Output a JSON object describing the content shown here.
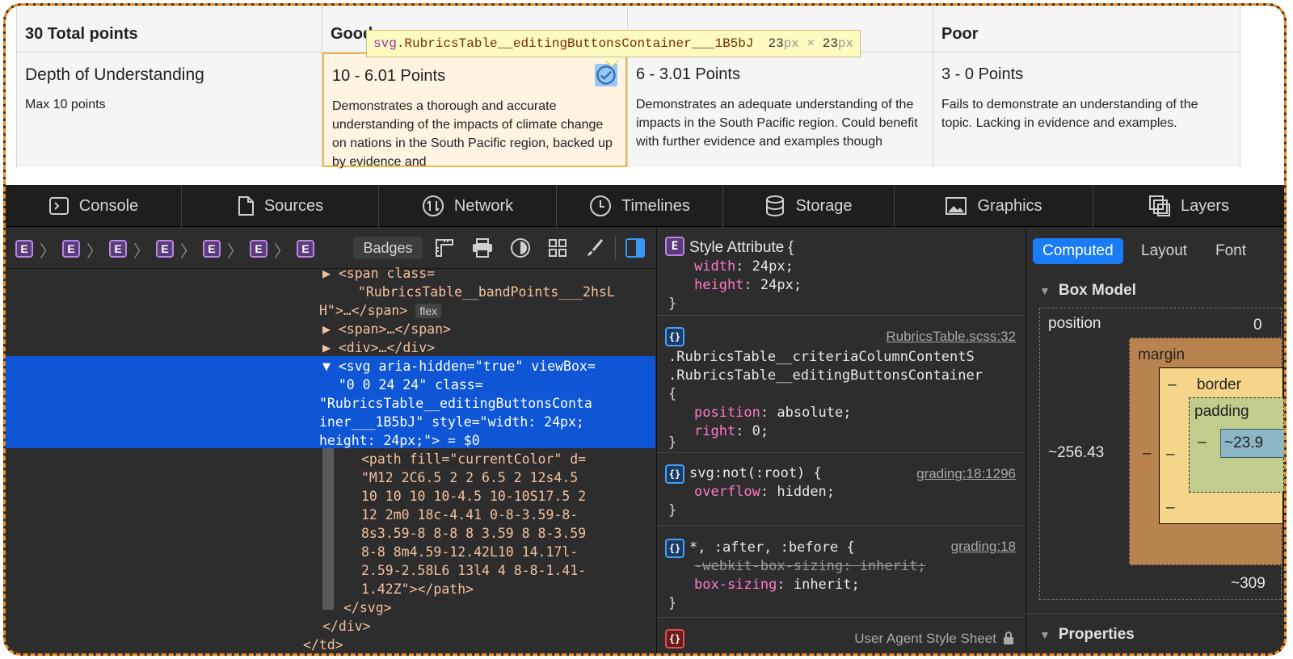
{
  "rubric": {
    "columns": [
      {
        "header": "30 Total points"
      },
      {
        "header": "Good"
      },
      {
        "header": ""
      },
      {
        "header": "Poor"
      }
    ],
    "criterion": {
      "title": "Depth of Understanding",
      "max": "Max 10 points"
    },
    "bands": [
      {
        "points": "10 - 6.01 Points",
        "desc": "Demonstrates a thorough and accurate understanding of the impacts of climate change on nations in the South Pacific region, backed up by evidence and",
        "selected": true
      },
      {
        "points": "6 - 3.01 Points",
        "desc": "Demonstrates an adequate understanding of the impacts in the South Pacific region. Could benefit with further evidence and examples though",
        "selected": false
      },
      {
        "points": "3 - 0 Points",
        "desc": "Fails to demonstrate an understanding of the topic. Lacking in evidence and examples.",
        "selected": false
      }
    ]
  },
  "tooltip": {
    "tag": "svg",
    "class": ".RubricsTable__editingButtonsContainer___1B5bJ",
    "w": "23",
    "h": "23",
    "unit": "px",
    "x": "×"
  },
  "devtools": {
    "tabs": [
      {
        "label": "Console",
        "icon": "console-icon"
      },
      {
        "label": "Sources",
        "icon": "document-icon"
      },
      {
        "label": "Network",
        "icon": "network-icon"
      },
      {
        "label": "Timelines",
        "icon": "clock-icon"
      },
      {
        "label": "Storage",
        "icon": "database-icon"
      },
      {
        "label": "Graphics",
        "icon": "image-icon"
      },
      {
        "label": "Layers",
        "icon": "layers-icon"
      }
    ],
    "breadcrumb_badge": "E",
    "badges_label": "Badges",
    "dom_lines": {
      "l1": "▶ <span class=",
      "l2": "  \"RubricsTable__bandPoints___2hsL",
      "l3": "H\">…</span>",
      "l3_badge": "flex",
      "l4": "▶ <span>…</span>",
      "l5": "▶ <div>…</div>",
      "s1": "▼ <svg aria-hidden=\"true\" viewBox=",
      "s2": "  \"0 0 24 24\" class=",
      "s3": "\"RubricsTable__editingButtonsConta",
      "s4": "iner___1B5bJ\" style=\"width: 24px;",
      "s5": "height: 24px;\"> = $0",
      "p1": "<path fill=\"currentColor\" d=",
      "p2": "\"M12 2C6.5 2 2 6.5 2 12s4.5",
      "p3": "10 10 10 10-4.5 10-10S17.5 2",
      "p4": "12 2m0 18c-4.41 0-8-3.59-8-",
      "p5": "8s3.59-8 8-8 8 3.59 8 8-3.59",
      "p6": "8-8 8m4.59-12.42L10 14.17l-",
      "p7": "2.59-2.58L6 13l4 4 8-8-1.41-",
      "p8": "1.42Z\"></path>",
      "c1": "</svg>",
      "c2": "</div>",
      "c3": "</td>"
    },
    "styles": {
      "r1_sel": "Style Attribute {",
      "r1_p1n": "width",
      "r1_p1v": "24px;",
      "r1_p2n": "height",
      "r1_p2v": "24px;",
      "r2_src": "RubricsTable.scss:32",
      "r2_s1": ".RubricsTable__criteriaColumnContentS",
      "r2_s2": ".RubricsTable__editingButtonsContainer",
      "r2_p1n": "position",
      "r2_p1v": "absolute;",
      "r2_p2n": "right",
      "r2_p2v": "0;",
      "r3_sel": "svg:not(:root) {",
      "r3_src": "grading:18:1296",
      "r3_p1n": "overflow",
      "r3_p1v": "hidden;",
      "r4_sel": "*, :after, :before {",
      "r4_src": "grading:18",
      "r4_p1": "-webkit-box-sizing: inherit;",
      "r4_p2n": "box-sizing",
      "r4_p2v": "inherit;",
      "r5_src": "User Agent Style Sheet",
      "icon_e": "E",
      "icon_rule": "{}",
      "open": "{",
      "close": "}"
    },
    "sidebar": {
      "tabs": [
        "Computed",
        "Layout",
        "Font"
      ],
      "box_model": "Box Model",
      "position": "position",
      "pos_top": "0",
      "pos_left": "~256.43",
      "pos_bottom": "~309",
      "margin": "margin",
      "border": "border",
      "padding": "padding",
      "content": "~23.9",
      "dash": "–",
      "properties": "Properties"
    }
  }
}
